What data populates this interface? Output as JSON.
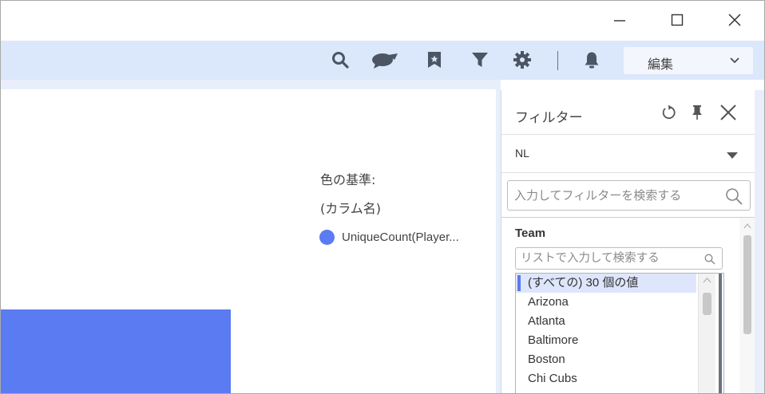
{
  "window": {
    "controls": [
      "minimize",
      "maximize",
      "close"
    ]
  },
  "toolbar": {
    "icons": [
      "search-icon",
      "comments-icon",
      "bookmark-icon",
      "filter-icon",
      "settings-icon",
      "notifications-icon"
    ],
    "mode_label": "編集"
  },
  "legend": {
    "title": "色の基準:",
    "subtitle": "(カラム名)",
    "item_label": "UniqueCount(Player...",
    "item_color": "#5b7bf2"
  },
  "visual": {
    "bar_color": "#5b7bf2"
  },
  "filter_panel": {
    "title": "フィルター",
    "scheme_value": "NL",
    "search_placeholder": "入力してフィルターを検索する",
    "team": {
      "label": "Team",
      "list_search_placeholder": "リストで入力して検索する",
      "items": [
        "(すべての) 30 個の値",
        "Arizona",
        "Atlanta",
        "Baltimore",
        "Boston",
        "Chi Cubs"
      ],
      "selected_index": 0
    }
  },
  "colors": {
    "accent": "#5b7bf2",
    "toolbar_bg": "#dbe7fb",
    "icon_dark": "#4b5563"
  }
}
